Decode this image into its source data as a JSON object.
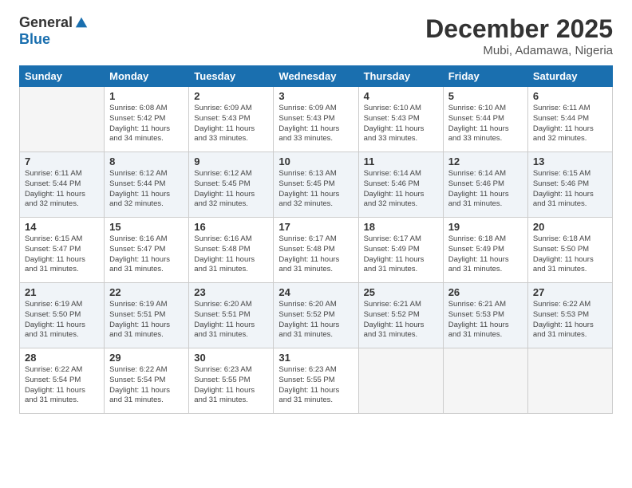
{
  "logo": {
    "general": "General",
    "blue": "Blue"
  },
  "title": "December 2025",
  "location": "Mubi, Adamawa, Nigeria",
  "days_of_week": [
    "Sunday",
    "Monday",
    "Tuesday",
    "Wednesday",
    "Thursday",
    "Friday",
    "Saturday"
  ],
  "weeks": [
    [
      {
        "num": "",
        "sunrise": "",
        "sunset": "",
        "daylight": "",
        "empty": true
      },
      {
        "num": "1",
        "sunrise": "Sunrise: 6:08 AM",
        "sunset": "Sunset: 5:42 PM",
        "daylight": "Daylight: 11 hours and 34 minutes."
      },
      {
        "num": "2",
        "sunrise": "Sunrise: 6:09 AM",
        "sunset": "Sunset: 5:43 PM",
        "daylight": "Daylight: 11 hours and 33 minutes."
      },
      {
        "num": "3",
        "sunrise": "Sunrise: 6:09 AM",
        "sunset": "Sunset: 5:43 PM",
        "daylight": "Daylight: 11 hours and 33 minutes."
      },
      {
        "num": "4",
        "sunrise": "Sunrise: 6:10 AM",
        "sunset": "Sunset: 5:43 PM",
        "daylight": "Daylight: 11 hours and 33 minutes."
      },
      {
        "num": "5",
        "sunrise": "Sunrise: 6:10 AM",
        "sunset": "Sunset: 5:44 PM",
        "daylight": "Daylight: 11 hours and 33 minutes."
      },
      {
        "num": "6",
        "sunrise": "Sunrise: 6:11 AM",
        "sunset": "Sunset: 5:44 PM",
        "daylight": "Daylight: 11 hours and 32 minutes."
      }
    ],
    [
      {
        "num": "7",
        "sunrise": "Sunrise: 6:11 AM",
        "sunset": "Sunset: 5:44 PM",
        "daylight": "Daylight: 11 hours and 32 minutes."
      },
      {
        "num": "8",
        "sunrise": "Sunrise: 6:12 AM",
        "sunset": "Sunset: 5:44 PM",
        "daylight": "Daylight: 11 hours and 32 minutes."
      },
      {
        "num": "9",
        "sunrise": "Sunrise: 6:12 AM",
        "sunset": "Sunset: 5:45 PM",
        "daylight": "Daylight: 11 hours and 32 minutes."
      },
      {
        "num": "10",
        "sunrise": "Sunrise: 6:13 AM",
        "sunset": "Sunset: 5:45 PM",
        "daylight": "Daylight: 11 hours and 32 minutes."
      },
      {
        "num": "11",
        "sunrise": "Sunrise: 6:14 AM",
        "sunset": "Sunset: 5:46 PM",
        "daylight": "Daylight: 11 hours and 32 minutes."
      },
      {
        "num": "12",
        "sunrise": "Sunrise: 6:14 AM",
        "sunset": "Sunset: 5:46 PM",
        "daylight": "Daylight: 11 hours and 31 minutes."
      },
      {
        "num": "13",
        "sunrise": "Sunrise: 6:15 AM",
        "sunset": "Sunset: 5:46 PM",
        "daylight": "Daylight: 11 hours and 31 minutes."
      }
    ],
    [
      {
        "num": "14",
        "sunrise": "Sunrise: 6:15 AM",
        "sunset": "Sunset: 5:47 PM",
        "daylight": "Daylight: 11 hours and 31 minutes."
      },
      {
        "num": "15",
        "sunrise": "Sunrise: 6:16 AM",
        "sunset": "Sunset: 5:47 PM",
        "daylight": "Daylight: 11 hours and 31 minutes."
      },
      {
        "num": "16",
        "sunrise": "Sunrise: 6:16 AM",
        "sunset": "Sunset: 5:48 PM",
        "daylight": "Daylight: 11 hours and 31 minutes."
      },
      {
        "num": "17",
        "sunrise": "Sunrise: 6:17 AM",
        "sunset": "Sunset: 5:48 PM",
        "daylight": "Daylight: 11 hours and 31 minutes."
      },
      {
        "num": "18",
        "sunrise": "Sunrise: 6:17 AM",
        "sunset": "Sunset: 5:49 PM",
        "daylight": "Daylight: 11 hours and 31 minutes."
      },
      {
        "num": "19",
        "sunrise": "Sunrise: 6:18 AM",
        "sunset": "Sunset: 5:49 PM",
        "daylight": "Daylight: 11 hours and 31 minutes."
      },
      {
        "num": "20",
        "sunrise": "Sunrise: 6:18 AM",
        "sunset": "Sunset: 5:50 PM",
        "daylight": "Daylight: 11 hours and 31 minutes."
      }
    ],
    [
      {
        "num": "21",
        "sunrise": "Sunrise: 6:19 AM",
        "sunset": "Sunset: 5:50 PM",
        "daylight": "Daylight: 11 hours and 31 minutes."
      },
      {
        "num": "22",
        "sunrise": "Sunrise: 6:19 AM",
        "sunset": "Sunset: 5:51 PM",
        "daylight": "Daylight: 11 hours and 31 minutes."
      },
      {
        "num": "23",
        "sunrise": "Sunrise: 6:20 AM",
        "sunset": "Sunset: 5:51 PM",
        "daylight": "Daylight: 11 hours and 31 minutes."
      },
      {
        "num": "24",
        "sunrise": "Sunrise: 6:20 AM",
        "sunset": "Sunset: 5:52 PM",
        "daylight": "Daylight: 11 hours and 31 minutes."
      },
      {
        "num": "25",
        "sunrise": "Sunrise: 6:21 AM",
        "sunset": "Sunset: 5:52 PM",
        "daylight": "Daylight: 11 hours and 31 minutes."
      },
      {
        "num": "26",
        "sunrise": "Sunrise: 6:21 AM",
        "sunset": "Sunset: 5:53 PM",
        "daylight": "Daylight: 11 hours and 31 minutes."
      },
      {
        "num": "27",
        "sunrise": "Sunrise: 6:22 AM",
        "sunset": "Sunset: 5:53 PM",
        "daylight": "Daylight: 11 hours and 31 minutes."
      }
    ],
    [
      {
        "num": "28",
        "sunrise": "Sunrise: 6:22 AM",
        "sunset": "Sunset: 5:54 PM",
        "daylight": "Daylight: 11 hours and 31 minutes."
      },
      {
        "num": "29",
        "sunrise": "Sunrise: 6:22 AM",
        "sunset": "Sunset: 5:54 PM",
        "daylight": "Daylight: 11 hours and 31 minutes."
      },
      {
        "num": "30",
        "sunrise": "Sunrise: 6:23 AM",
        "sunset": "Sunset: 5:55 PM",
        "daylight": "Daylight: 11 hours and 31 minutes."
      },
      {
        "num": "31",
        "sunrise": "Sunrise: 6:23 AM",
        "sunset": "Sunset: 5:55 PM",
        "daylight": "Daylight: 11 hours and 31 minutes."
      },
      {
        "num": "",
        "sunrise": "",
        "sunset": "",
        "daylight": "",
        "empty": true
      },
      {
        "num": "",
        "sunrise": "",
        "sunset": "",
        "daylight": "",
        "empty": true
      },
      {
        "num": "",
        "sunrise": "",
        "sunset": "",
        "daylight": "",
        "empty": true
      }
    ]
  ]
}
